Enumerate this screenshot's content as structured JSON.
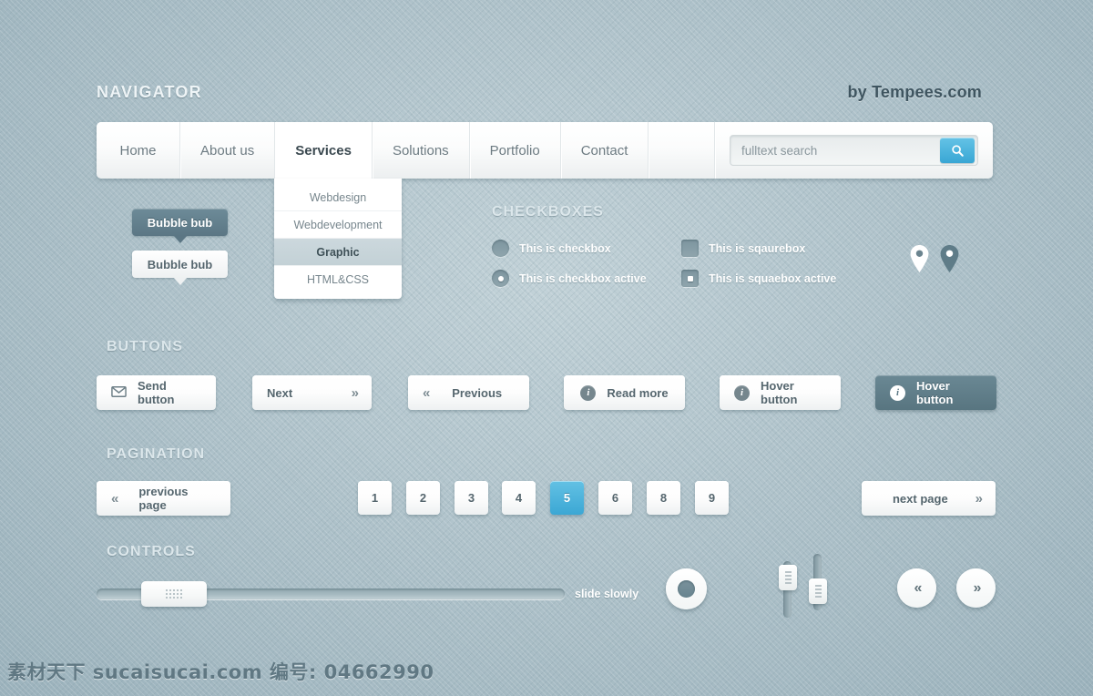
{
  "header": {
    "brand_left": "NAVIGATOR",
    "brand_right": "by Tempees.com"
  },
  "nav": {
    "items": [
      {
        "label": "Home",
        "state": "normal"
      },
      {
        "label": "About us",
        "state": "normal"
      },
      {
        "label": "Services",
        "state": "open"
      },
      {
        "label": "Solutions",
        "state": "normal"
      },
      {
        "label": "Portfolio",
        "state": "normal"
      },
      {
        "label": "Contact",
        "state": "normal"
      }
    ]
  },
  "search": {
    "placeholder": "fulltext search",
    "value": "",
    "button_icon": "search-icon",
    "accent_color": "#3ba7d4"
  },
  "dropdown": {
    "items": [
      {
        "label": "Webdesign",
        "active": false
      },
      {
        "label": "Webdevelopment",
        "active": false
      },
      {
        "label": "Graphic",
        "active": true
      },
      {
        "label": "HTML&CSS",
        "active": false
      }
    ]
  },
  "bubbles": {
    "dark_label": "Bubble bub",
    "light_label": "Bubble bub"
  },
  "sections": {
    "checkboxes": "CHECKBOXES",
    "buttons": "BUTTONS",
    "pagination": "PAGINATION",
    "controls": "CONTROLS"
  },
  "checkboxes": [
    {
      "label": "This is checkbox",
      "shape": "circle",
      "checked": false
    },
    {
      "label": "This is sqaurebox",
      "shape": "square",
      "checked": false
    },
    {
      "label": "This is checkbox active",
      "shape": "circle",
      "checked": true
    },
    {
      "label": "This is squaebox active",
      "shape": "square",
      "checked": true
    }
  ],
  "pins": [
    {
      "name": "map-pin-light",
      "fill": "#ffffff",
      "hole": "#6b848f"
    },
    {
      "name": "map-pin-dark",
      "fill": "#5f7c88",
      "hole": "#ffffff"
    }
  ],
  "buttons": [
    {
      "label": "Send button",
      "icon": "mail-icon",
      "icon_side": "left",
      "style": "light"
    },
    {
      "label": "Next",
      "icon": "chevron-double-right-icon",
      "icon_side": "right",
      "style": "light"
    },
    {
      "label": "Previous",
      "icon": "chevron-double-left-icon",
      "icon_side": "left",
      "style": "light"
    },
    {
      "label": "Read more",
      "icon": "info-icon",
      "icon_side": "left",
      "style": "light"
    },
    {
      "label": "Hover button",
      "icon": "info-icon",
      "icon_side": "left",
      "style": "light"
    },
    {
      "label": "Hover button",
      "icon": "info-icon",
      "icon_side": "left",
      "style": "dark"
    }
  ],
  "pagination": {
    "previous_label": "previous page",
    "next_label": "next page",
    "pages": [
      {
        "label": "1",
        "active": false
      },
      {
        "label": "2",
        "active": false
      },
      {
        "label": "3",
        "active": false
      },
      {
        "label": "4",
        "active": false
      },
      {
        "label": "5",
        "active": true
      },
      {
        "label": "6",
        "active": false
      },
      {
        "label": "8",
        "active": false
      },
      {
        "label": "9",
        "active": false
      }
    ],
    "active_color": "#3ba7d4"
  },
  "controls": {
    "slider_label": "slide slowly",
    "slider_value_pct": 18,
    "vslider_left_pct": 28,
    "vslider_right_pct": 62,
    "prev_icon": "chevron-double-left-icon",
    "next_icon": "chevron-double-right-icon",
    "chev_left": "«",
    "chev_right": "»"
  },
  "watermark": "素材天下 sucaisucai.com  编号: 04662990",
  "theme": {
    "background": "#b4c6cd",
    "dark_button": "#5f7c88",
    "text_dark": "#55666e"
  }
}
